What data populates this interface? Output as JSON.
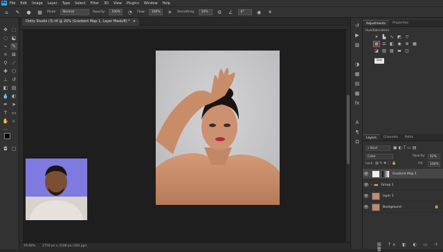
{
  "app": {
    "logo": "Ps"
  },
  "menu": [
    "File",
    "Edit",
    "Image",
    "Layer",
    "Type",
    "Select",
    "Filter",
    "3D",
    "View",
    "Plugins",
    "Window",
    "Help"
  ],
  "options": {
    "home_icon": "home-icon",
    "brush_icon": "brush-icon",
    "mode_label": "Mode:",
    "mode_value": "Normal",
    "opacity_label": "Opacity:",
    "opacity_value": "100%",
    "flow_label": "Flow:",
    "flow_value": "100%",
    "smoothing_label": "Smoothing:",
    "smoothing_value": "10%",
    "angle_value": "0°"
  },
  "document": {
    "tab_title": "Dotty Studio (3).tif @ 20% (Gradient Map 1, Layer Mask/8) *",
    "close": "×",
    "zoom": "19.98%",
    "doc_size": "2750 px x 3108 px (300 ppi)"
  },
  "adjustments": {
    "tabs": [
      "Adjustments",
      "Properties"
    ],
    "subtitle": "Hue/Saturation",
    "tooltip": "Dot"
  },
  "layers_panel": {
    "tabs": [
      "Layers",
      "Channels",
      "Paths"
    ],
    "filter_label": "Kind",
    "blend_mode": "Color",
    "opacity_label": "Opacity:",
    "opacity_value": "42%",
    "lock_label": "Lock:",
    "fill_label": "Fill:",
    "fill_value": "100%",
    "layers": [
      {
        "name": "Gradient Map 1",
        "selected": true
      },
      {
        "name": "Group 1",
        "selected": false
      },
      {
        "name": "layer 1",
        "selected": false
      },
      {
        "name": "Background",
        "selected": false
      }
    ]
  },
  "colors": {
    "accent": "#31a8ff",
    "highlight": "#e05050"
  }
}
